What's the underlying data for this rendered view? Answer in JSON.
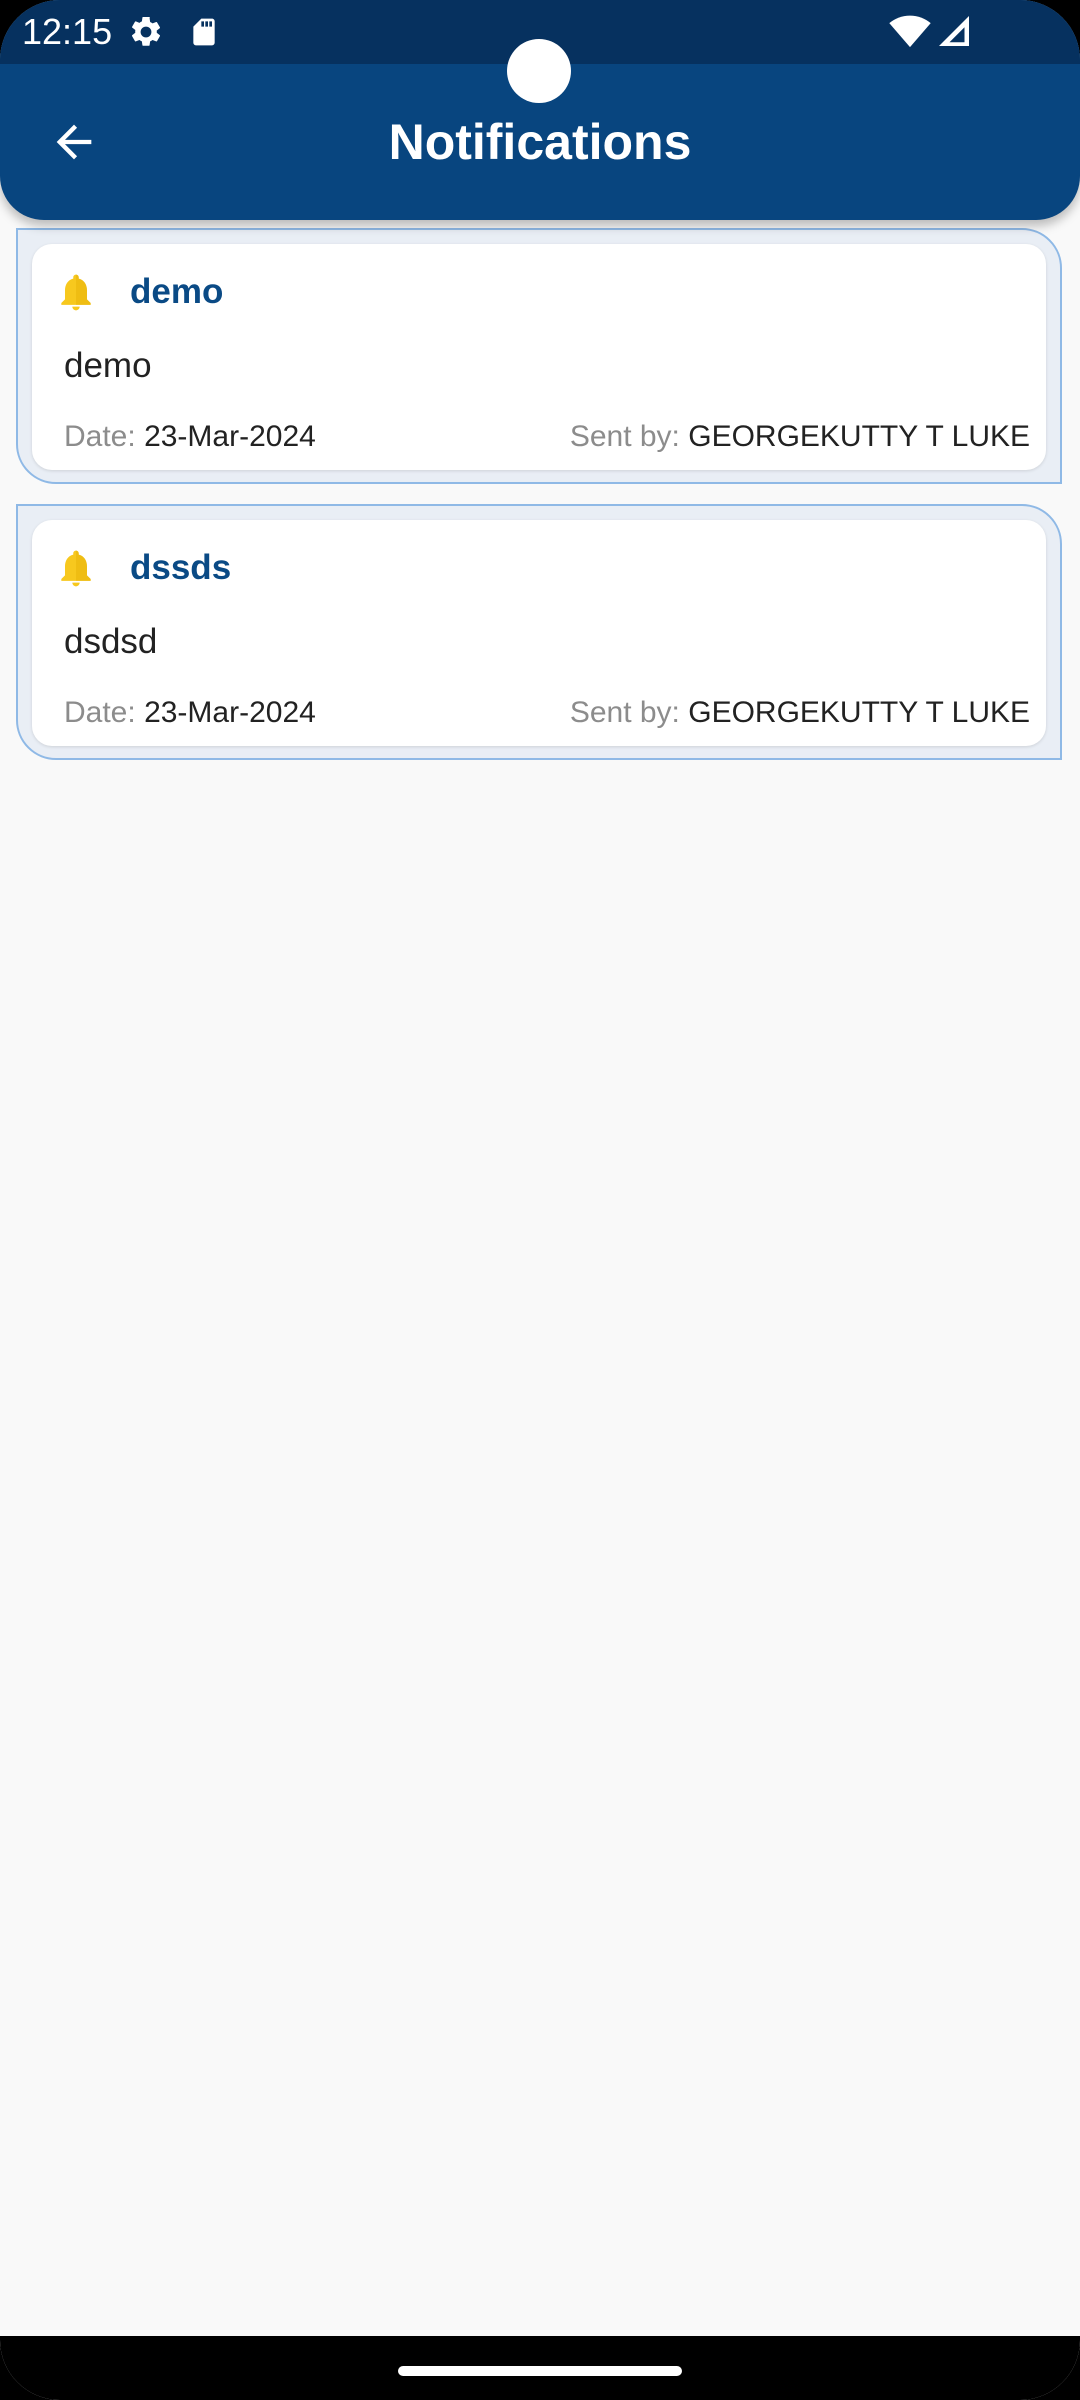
{
  "status_bar": {
    "time": "12:15",
    "icons": [
      "gear-icon",
      "sd-card-icon",
      "wifi-icon",
      "signal-icon"
    ]
  },
  "app_bar": {
    "title": "Notifications",
    "back_icon": "arrow-left-icon"
  },
  "colors": {
    "app_bar": "#08457f",
    "status_bar": "#06315f",
    "title_accent": "#0a4a85",
    "card_border": "#8fb9e6",
    "bell": "#f7c81e",
    "background": "#f9f9f9"
  },
  "notifications": [
    {
      "title": "demo",
      "body": "demo",
      "date_label": "Date:",
      "date": "23-Mar-2024",
      "sent_label": "Sent by:",
      "sender": "GEORGEKUTTY T LUKE"
    },
    {
      "title": "dssds",
      "body": "dsdsd",
      "date_label": "Date:",
      "date": "23-Mar-2024",
      "sent_label": "Sent by:",
      "sender": "GEORGEKUTTY T LUKE"
    }
  ]
}
